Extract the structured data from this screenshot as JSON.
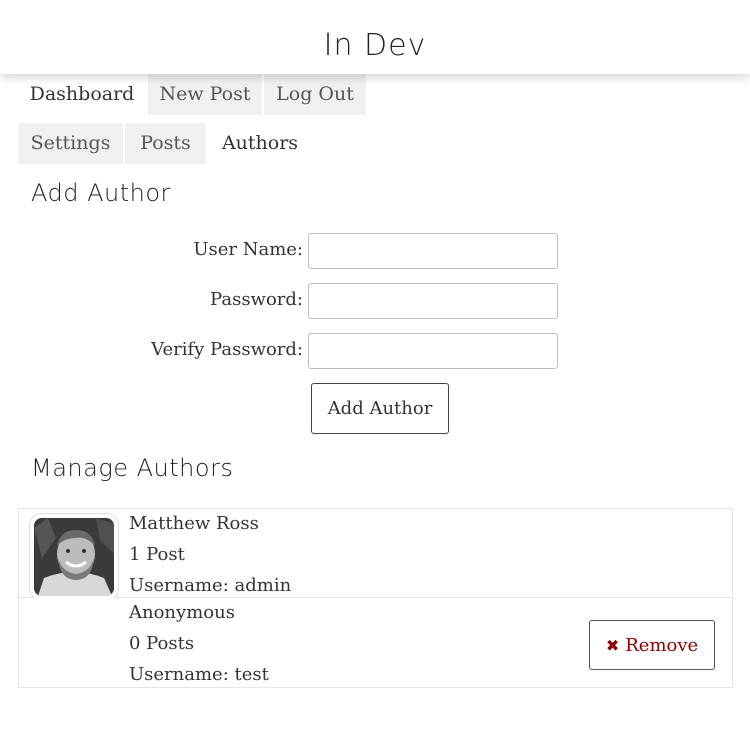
{
  "site": {
    "title": "In Dev"
  },
  "nav": {
    "primary": [
      "Dashboard",
      "New Post",
      "Log Out"
    ],
    "secondary": [
      "Settings",
      "Posts",
      "Authors"
    ],
    "active_primary": "Dashboard",
    "active_secondary": "Authors"
  },
  "add_author": {
    "heading": "Add Author",
    "fields": [
      {
        "label": "User Name:",
        "value": ""
      },
      {
        "label": "Password:",
        "value": ""
      },
      {
        "label": "Verify Password:",
        "value": ""
      }
    ],
    "submit_label": "Add Author"
  },
  "manage": {
    "heading": "Manage Authors",
    "authors": [
      {
        "name": "Matthew Ross",
        "posts": "1 Post",
        "username": "Username: admin",
        "has_avatar": true,
        "removable": false
      },
      {
        "name": "Anonymous",
        "posts": "0 Posts",
        "username": "Username: test",
        "has_avatar": false,
        "removable": true,
        "remove_label": "Remove",
        "remove_icon": "close-icon"
      }
    ]
  },
  "colors": {
    "remove": "#8b0000",
    "tab_inactive": "#f0f0f0"
  }
}
